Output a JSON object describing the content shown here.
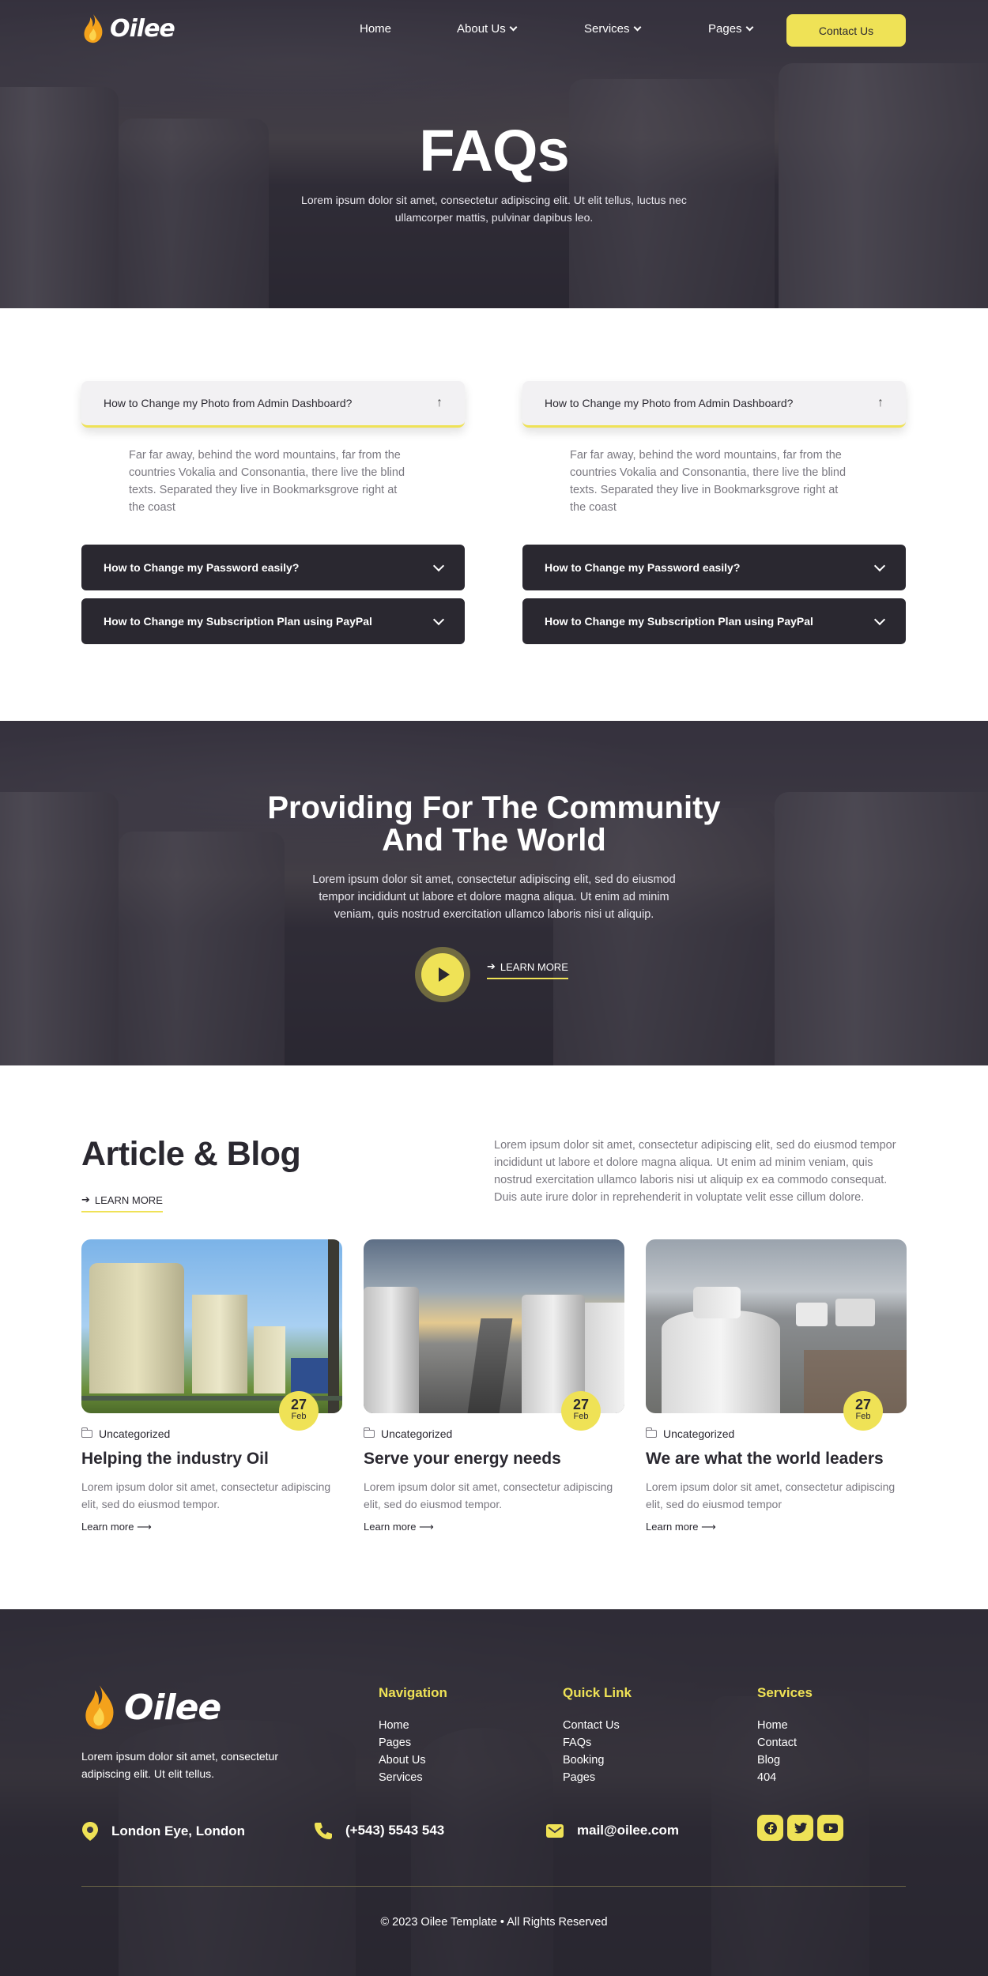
{
  "brand": {
    "name": "Oilee",
    "accent": "#efe256",
    "dark": "#2a2830"
  },
  "nav": {
    "items": [
      {
        "label": "Home",
        "has_dropdown": false
      },
      {
        "label": "About Us",
        "has_dropdown": true
      },
      {
        "label": "Services",
        "has_dropdown": true
      },
      {
        "label": "Pages",
        "has_dropdown": true
      }
    ],
    "contact_button": "Contact Us"
  },
  "hero": {
    "title": "FAQs",
    "subtitle": "Lorem ipsum dolor sit amet, consectetur adipiscing elit. Ut elit tellus, luctus nec ullamcorper mattis, pulvinar dapibus leo."
  },
  "faq": {
    "columns": [
      {
        "open_question": "How to Change my Photo from Admin Dashboard?",
        "open_answer": "Far far away, behind the word mountains, far from the countries Vokalia and Consonantia, there live the blind texts. Separated they live in Bookmarksgrove right at the coast",
        "closed": [
          "How to Change my Password easily?",
          "How to Change my Subscription Plan using PayPal"
        ]
      },
      {
        "open_question": "How to Change my Photo from Admin Dashboard?",
        "open_answer": "Far far away, behind the word mountains, far from the countries Vokalia and Consonantia, there live the blind texts. Separated they live in Bookmarksgrove right at the coast",
        "closed": [
          "How to Change my Password easily?",
          "How to Change my Subscription Plan using PayPal"
        ]
      }
    ]
  },
  "community": {
    "title": "Providing For The Community And The World",
    "text": "Lorem ipsum dolor sit amet, consectetur adipiscing elit, sed do eiusmod tempor incididunt ut labore et dolore magna aliqua. Ut enim ad minim veniam, quis nostrud exercitation ullamco laboris nisi ut aliquip.",
    "learn_more": "LEARN MORE"
  },
  "blog": {
    "title": "Article & Blog",
    "learn_more": "LEARN MORE",
    "intro": "Lorem ipsum dolor sit amet, consectetur adipiscing elit, sed do eiusmod tempor incididunt ut labore et dolore magna aliqua. Ut enim ad minim veniam, quis nostrud exercitation ullamco laboris nisi ut aliquip ex ea commodo consequat. Duis aute irure dolor in reprehenderit in voluptate velit esse cillum dolore.",
    "cards": [
      {
        "day": "27",
        "month": "Feb",
        "category": "Uncategorized",
        "title": "Helping the industry Oil",
        "excerpt": "Lorem ipsum dolor sit amet, consectetur adipiscing elit, sed do eiusmod tempor.",
        "more": "Learn more ⟶"
      },
      {
        "day": "27",
        "month": "Feb",
        "category": "Uncategorized",
        "title": "Serve your energy needs",
        "excerpt": "Lorem ipsum dolor sit amet, consectetur adipiscing elit, sed do eiusmod tempor.",
        "more": "Learn more ⟶"
      },
      {
        "day": "27",
        "month": "Feb",
        "category": "Uncategorized",
        "title": "We are what the world leaders",
        "excerpt": "Lorem ipsum dolor sit amet, consectetur adipiscing elit, sed do eiusmod tempor",
        "more": "Learn more ⟶"
      }
    ]
  },
  "footer": {
    "about": "Lorem ipsum dolor sit amet, consectetur adipiscing elit. Ut elit tellus.",
    "navigation": {
      "heading": "Navigation",
      "links": [
        "Home",
        "Pages",
        "About Us",
        "Services"
      ]
    },
    "quick_link": {
      "heading": "Quick Link",
      "links": [
        "Contact Us",
        "FAQs",
        "Booking",
        "Pages"
      ]
    },
    "services": {
      "heading": "Services",
      "links": [
        "Home",
        "Contact",
        "Blog",
        "404"
      ]
    },
    "address": "London Eye, London",
    "phone": "(+543) 5543 543",
    "email": "mail@oilee.com",
    "social": [
      "facebook-icon",
      "twitter-icon",
      "youtube-icon"
    ],
    "copyright": "© 2023 Oilee Template • All Rights Reserved"
  }
}
